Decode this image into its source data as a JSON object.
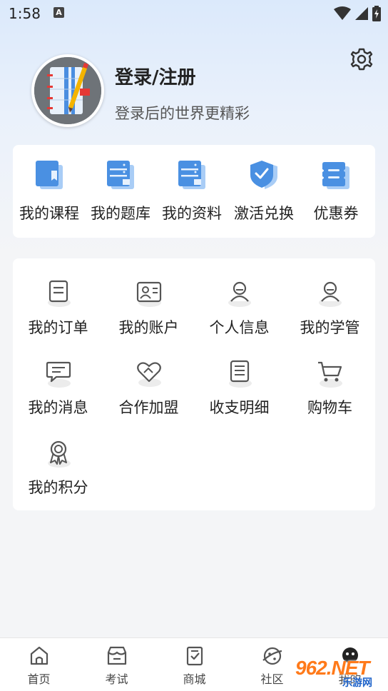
{
  "status_bar": {
    "time": "1:58",
    "notification_letter": "A"
  },
  "profile": {
    "title": "登录/注册",
    "subtitle": "登录后的世界更精彩"
  },
  "quick_actions": [
    {
      "label": "我的课程",
      "icon": "course-icon"
    },
    {
      "label": "我的题库",
      "icon": "question-bank-icon"
    },
    {
      "label": "我的资料",
      "icon": "materials-icon"
    },
    {
      "label": "激活兑换",
      "icon": "activate-shield-icon"
    },
    {
      "label": "优惠券",
      "icon": "coupon-icon"
    }
  ],
  "menu_items": [
    {
      "label": "我的订单",
      "icon": "order-icon"
    },
    {
      "label": "我的账户",
      "icon": "account-card-icon"
    },
    {
      "label": "个人信息",
      "icon": "user-info-icon"
    },
    {
      "label": "我的学管",
      "icon": "study-manager-icon"
    },
    {
      "label": "我的消息",
      "icon": "message-icon"
    },
    {
      "label": "合作加盟",
      "icon": "partnership-heart-icon"
    },
    {
      "label": "收支明细",
      "icon": "ledger-list-icon"
    },
    {
      "label": "购物车",
      "icon": "cart-icon"
    },
    {
      "label": "我的积分",
      "icon": "points-medal-icon"
    }
  ],
  "bottom_nav": [
    {
      "label": "首页",
      "icon": "home-icon"
    },
    {
      "label": "考试",
      "icon": "exam-icon"
    },
    {
      "label": "商城",
      "icon": "mall-icon"
    },
    {
      "label": "社区",
      "icon": "community-icon"
    },
    {
      "label": "我的",
      "icon": "profile-icon"
    }
  ],
  "watermark": {
    "main": "962.NET",
    "sub": "乐游网"
  },
  "colors": {
    "accent_blue": "#4a90e2",
    "icon_gray": "#5a5a5a",
    "background": "#f4f5f7"
  }
}
